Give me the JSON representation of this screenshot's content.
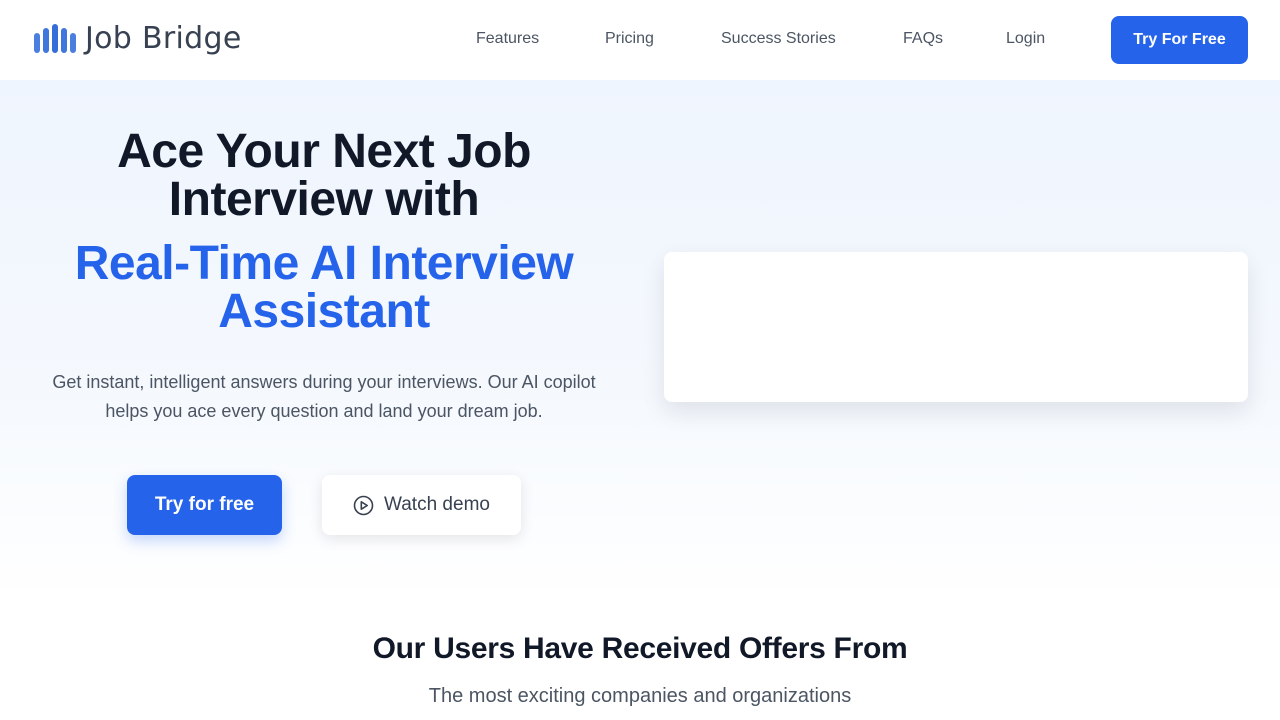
{
  "brand": {
    "name": "Job Bridge",
    "accent": "#2563eb",
    "logo_icon": "sound-bars-icon"
  },
  "nav": {
    "links": [
      "Features",
      "Pricing",
      "Success Stories",
      "FAQs",
      "Login"
    ],
    "cta_label": "Try For Free"
  },
  "hero": {
    "headline": "Ace Your Next Job Interview with",
    "headline_accent": "Real-Time AI Interview Assistant",
    "subtext": "Get instant, intelligent answers during your interviews. Our AI copilot helps you ace every question and land your dream job.",
    "primary_label": "Try for free",
    "secondary_label": "Watch demo",
    "secondary_icon": "play-circle-icon"
  },
  "offers": {
    "title": "Our Users Have Received Offers From",
    "subtitle": "The most exciting companies and organizations"
  }
}
